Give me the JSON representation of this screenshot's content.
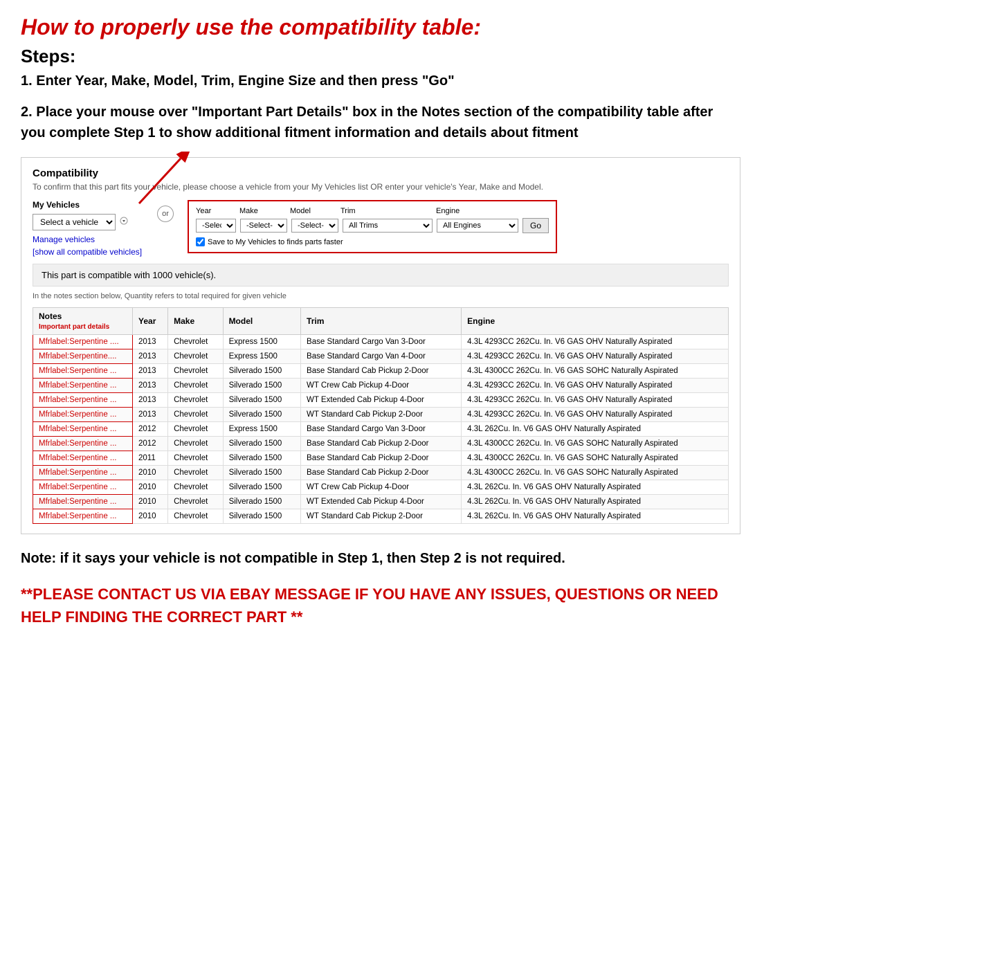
{
  "heading": {
    "title": "How to properly use the compatibility table:",
    "steps_label": "Steps:",
    "step1": "1. Enter Year, Make, Model, Trim, Engine Size and then press \"Go\"",
    "step2": "2. Place your mouse over \"Important Part Details\" box in the Notes section of the compatibility table after you complete Step 1 to show additional fitment information and details about fitment"
  },
  "compatibility": {
    "section_title": "Compatibility",
    "subtitle": "To confirm that this part fits your vehicle, please choose a vehicle from your My Vehicles list OR enter your vehicle's Year, Make and Model.",
    "my_vehicles_label": "My Vehicles",
    "select_vehicle_placeholder": "Select a vehicle",
    "or_label": "or",
    "manage_vehicles_link": "Manage vehicles",
    "show_all_link": "[show all compatible vehicles]",
    "year_label": "Year",
    "make_label": "Make",
    "model_label": "Model",
    "trim_label": "Trim",
    "engine_label": "Engine",
    "year_select": "-Select-",
    "make_select": "-Select-",
    "model_select": "-Select-",
    "trim_select": "All Trims",
    "engine_select": "All Engines",
    "go_button": "Go",
    "save_checkbox_label": "Save to My Vehicles to finds parts faster",
    "compatible_count": "This part is compatible with 1000 vehicle(s).",
    "quantity_note": "In the notes section below, Quantity refers to total required for given vehicle",
    "table_headers": {
      "notes": "Notes",
      "notes_sub": "Important part details",
      "year": "Year",
      "make": "Make",
      "model": "Model",
      "trim": "Trim",
      "engine": "Engine"
    },
    "rows": [
      {
        "notes": "Mfrlabel:Serpentine ....",
        "year": "2013",
        "make": "Chevrolet",
        "model": "Express 1500",
        "trim": "Base Standard Cargo Van 3-Door",
        "engine": "4.3L 4293CC 262Cu. In. V6 GAS OHV Naturally Aspirated"
      },
      {
        "notes": "Mfrlabel:Serpentine....",
        "year": "2013",
        "make": "Chevrolet",
        "model": "Express 1500",
        "trim": "Base Standard Cargo Van 4-Door",
        "engine": "4.3L 4293CC 262Cu. In. V6 GAS OHV Naturally Aspirated"
      },
      {
        "notes": "Mfrlabel:Serpentine ...",
        "year": "2013",
        "make": "Chevrolet",
        "model": "Silverado 1500",
        "trim": "Base Standard Cab Pickup 2-Door",
        "engine": "4.3L 4300CC 262Cu. In. V6 GAS SOHC Naturally Aspirated"
      },
      {
        "notes": "Mfrlabel:Serpentine ...",
        "year": "2013",
        "make": "Chevrolet",
        "model": "Silverado 1500",
        "trim": "WT Crew Cab Pickup 4-Door",
        "engine": "4.3L 4293CC 262Cu. In. V6 GAS OHV Naturally Aspirated"
      },
      {
        "notes": "Mfrlabel:Serpentine ...",
        "year": "2013",
        "make": "Chevrolet",
        "model": "Silverado 1500",
        "trim": "WT Extended Cab Pickup 4-Door",
        "engine": "4.3L 4293CC 262Cu. In. V6 GAS OHV Naturally Aspirated"
      },
      {
        "notes": "Mfrlabel:Serpentine ...",
        "year": "2013",
        "make": "Chevrolet",
        "model": "Silverado 1500",
        "trim": "WT Standard Cab Pickup 2-Door",
        "engine": "4.3L 4293CC 262Cu. In. V6 GAS OHV Naturally Aspirated"
      },
      {
        "notes": "Mfrlabel:Serpentine ...",
        "year": "2012",
        "make": "Chevrolet",
        "model": "Express 1500",
        "trim": "Base Standard Cargo Van 3-Door",
        "engine": "4.3L 262Cu. In. V6 GAS OHV Naturally Aspirated"
      },
      {
        "notes": "Mfrlabel:Serpentine ...",
        "year": "2012",
        "make": "Chevrolet",
        "model": "Silverado 1500",
        "trim": "Base Standard Cab Pickup 2-Door",
        "engine": "4.3L 4300CC 262Cu. In. V6 GAS SOHC Naturally Aspirated"
      },
      {
        "notes": "Mfrlabel:Serpentine ...",
        "year": "2011",
        "make": "Chevrolet",
        "model": "Silverado 1500",
        "trim": "Base Standard Cab Pickup 2-Door",
        "engine": "4.3L 4300CC 262Cu. In. V6 GAS SOHC Naturally Aspirated"
      },
      {
        "notes": "Mfrlabel:Serpentine ...",
        "year": "2010",
        "make": "Chevrolet",
        "model": "Silverado 1500",
        "trim": "Base Standard Cab Pickup 2-Door",
        "engine": "4.3L 4300CC 262Cu. In. V6 GAS SOHC Naturally Aspirated"
      },
      {
        "notes": "Mfrlabel:Serpentine ...",
        "year": "2010",
        "make": "Chevrolet",
        "model": "Silverado 1500",
        "trim": "WT Crew Cab Pickup 4-Door",
        "engine": "4.3L 262Cu. In. V6 GAS OHV Naturally Aspirated"
      },
      {
        "notes": "Mfrlabel:Serpentine ...",
        "year": "2010",
        "make": "Chevrolet",
        "model": "Silverado 1500",
        "trim": "WT Extended Cab Pickup 4-Door",
        "engine": "4.3L 262Cu. In. V6 GAS OHV Naturally Aspirated"
      },
      {
        "notes": "Mfrlabel:Serpentine ...",
        "year": "2010",
        "make": "Chevrolet",
        "model": "Silverado 1500",
        "trim": "WT Standard Cab Pickup 2-Door",
        "engine": "4.3L 262Cu. In. V6 GAS OHV Naturally Aspirated"
      }
    ]
  },
  "note_section": {
    "text": "Note: if it says your vehicle is not compatible in Step 1, then Step 2 is not required."
  },
  "contact_section": {
    "text": "**PLEASE CONTACT US VIA EBAY MESSAGE IF YOU HAVE ANY ISSUES, QUESTIONS OR NEED HELP FINDING THE CORRECT PART **"
  }
}
